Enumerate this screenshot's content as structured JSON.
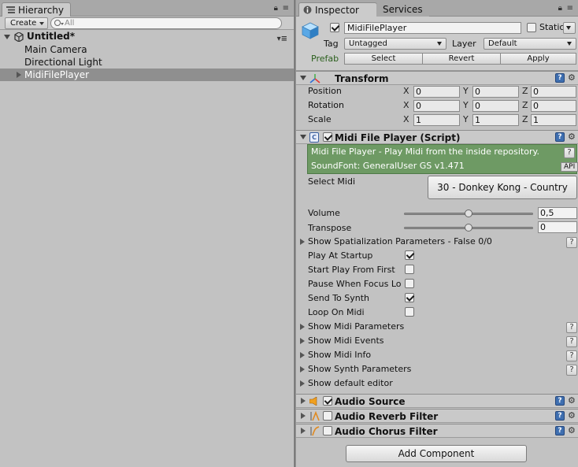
{
  "hierarchy": {
    "tab_label": "Hierarchy",
    "create_label": "Create",
    "search_placeholder": "All",
    "scene_name": "Untitled*",
    "items": [
      "Main Camera",
      "Directional Light",
      "MidiFilePlayer"
    ],
    "selected_item": "MidiFilePlayer"
  },
  "inspector": {
    "tabs": [
      "Inspector",
      "Services"
    ],
    "object_name": "MidiFilePlayer",
    "static_label": "Static",
    "tag_label": "Tag",
    "tag_value": "Untagged",
    "layer_label": "Layer",
    "layer_value": "Default",
    "prefab_label": "Prefab",
    "prefab_buttons": [
      "Select",
      "Revert",
      "Apply"
    ]
  },
  "transform": {
    "title": "Transform",
    "rows": [
      {
        "label": "Position",
        "x": "0",
        "y": "0",
        "z": "0"
      },
      {
        "label": "Rotation",
        "x": "0",
        "y": "0",
        "z": "0"
      },
      {
        "label": "Scale",
        "x": "1",
        "y": "1",
        "z": "1"
      }
    ],
    "axis_labels": [
      "X",
      "Y",
      "Z"
    ]
  },
  "midi_player": {
    "title": "Midi File Player (Script)",
    "info_line1": "Midi File Player - Play Midi from the inside repository.",
    "info_line2": "SoundFont: GeneralUser GS v1.471",
    "api_label": "API",
    "help_label": "?",
    "select_midi_label": "Select Midi",
    "select_midi_value": "30 - Donkey Kong - Country",
    "volume_label": "Volume",
    "volume_value": "0,5",
    "volume_fraction": 0.5,
    "transpose_label": "Transpose",
    "transpose_value": "0",
    "transpose_fraction": 0.5,
    "spatialization_label": "Show Spatialization Parameters - False 0/0",
    "toggles": [
      {
        "label": "Play At Startup",
        "checked": true
      },
      {
        "label": "Start Play From First",
        "checked": false
      },
      {
        "label": "Pause When Focus Lo",
        "checked": false
      },
      {
        "label": "Send To Synth",
        "checked": true
      },
      {
        "label": "Loop On Midi",
        "checked": false
      }
    ],
    "foldouts": [
      "Show Midi Parameters",
      "Show Midi Events",
      "Show Midi Info",
      "Show Synth Parameters",
      "Show default editor"
    ]
  },
  "components": [
    "Audio Source",
    "Audio Reverb Filter",
    "Audio Chorus Filter"
  ],
  "add_component_label": "Add Component",
  "colors": {
    "panel": "#c2c2c2",
    "selection": "#8f8f8f",
    "info_green": "#6e9a64",
    "help_blue": "#3f6fb0"
  }
}
